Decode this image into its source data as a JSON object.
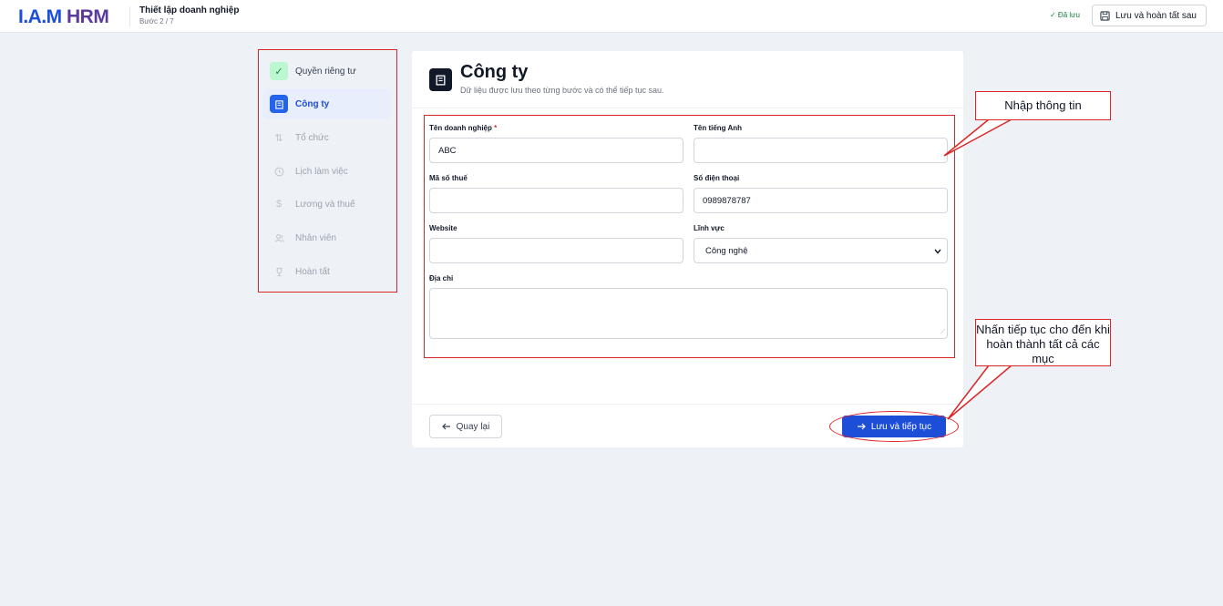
{
  "header": {
    "logo_part1": "I.A.M",
    "logo_part2": "HRM",
    "title": "Thiết lập doanh nghiệp",
    "step": "Bước 2 / 7",
    "saved_status": "✓ Đã lưu",
    "save_later_label": "Lưu và hoàn tất sau"
  },
  "sidebar": {
    "items": [
      {
        "label": "Quyền riêng tư",
        "state": "done",
        "icon": "check-icon"
      },
      {
        "label": "Công ty",
        "state": "active",
        "icon": "building-icon"
      },
      {
        "label": "Tổ chức",
        "state": "pending",
        "icon": "org-chart-icon"
      },
      {
        "label": "Lịch làm việc",
        "state": "pending",
        "icon": "clock-icon"
      },
      {
        "label": "Lương và thuế",
        "state": "pending",
        "icon": "dollar-icon"
      },
      {
        "label": "Nhân viên",
        "state": "pending",
        "icon": "users-icon"
      },
      {
        "label": "Hoàn tất",
        "state": "pending",
        "icon": "trophy-icon"
      }
    ]
  },
  "card": {
    "title": "Công ty",
    "subtitle": "Dữ liệu được lưu theo từng bước và có thể tiếp tục sau."
  },
  "form": {
    "company_name_label": "Tên doanh nghiệp",
    "company_name_required": "*",
    "company_name_value": "ABC",
    "english_name_label": "Tên tiếng Anh",
    "english_name_value": "",
    "tax_code_label": "Mã số thuế",
    "tax_code_value": "",
    "phone_label": "Số điện thoại",
    "phone_value": "0989878787",
    "website_label": "Website",
    "website_value": "",
    "industry_label": "Lĩnh vực",
    "industry_value": "Công nghệ",
    "address_label": "Địa chỉ",
    "address_value": ""
  },
  "footer": {
    "back_label": "Quay lại",
    "next_label": "Lưu và tiếp tục"
  },
  "annotations": {
    "callout1": "Nhập thông tin",
    "callout2": "Nhấn tiếp tục cho đến khi hoàn thành tất cả các mục"
  },
  "colors": {
    "accent": "#1d4ed8",
    "annotation": "#dc2626",
    "done": "#15803d",
    "background": "#eef2f7"
  }
}
